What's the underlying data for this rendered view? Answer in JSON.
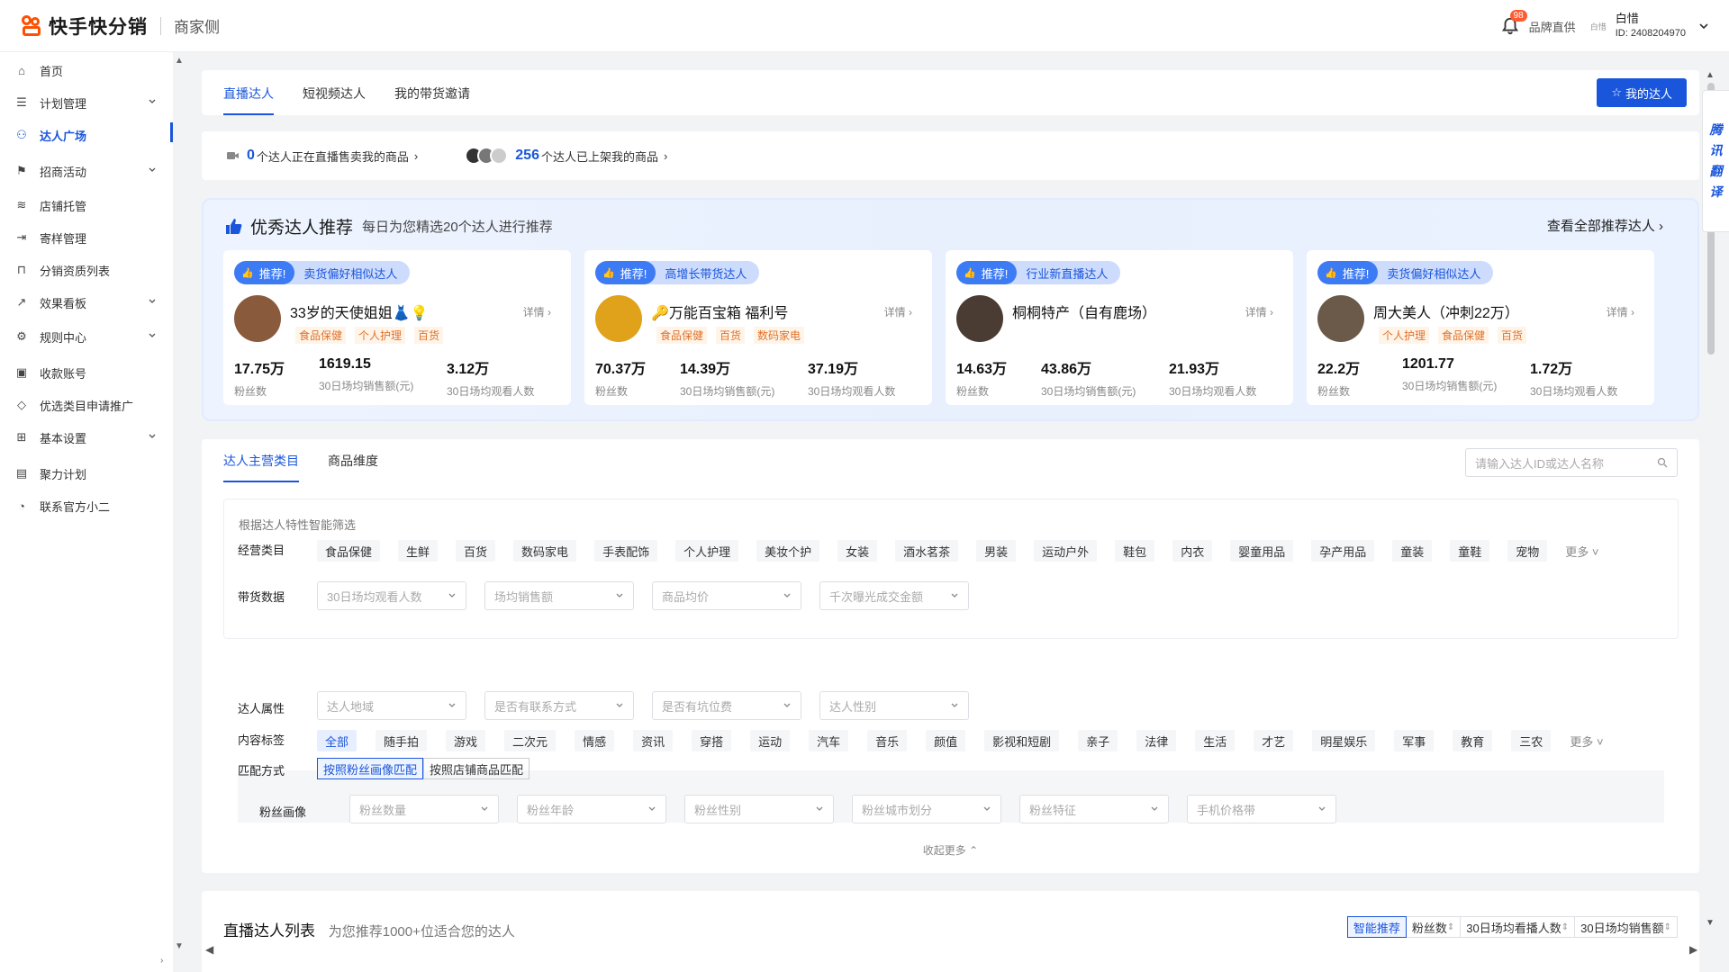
{
  "header": {
    "app_title": "快手快分销",
    "app_sub": "商家侧",
    "notif_count": "98",
    "brand_label": "品牌直供",
    "mini_logo": "白惜",
    "user_name": "白惜",
    "user_id": "ID: 2408204970"
  },
  "sidebar": {
    "items": [
      {
        "label": "首页",
        "icon": "home-icon"
      },
      {
        "label": "计划管理",
        "icon": "plan-icon",
        "expandable": true
      },
      {
        "label": "达人广场",
        "icon": "user-icon",
        "active": true
      },
      {
        "label": "招商活动",
        "icon": "flag-icon",
        "expandable": true
      },
      {
        "label": "店铺托管",
        "icon": "layers-icon"
      },
      {
        "label": "寄样管理",
        "icon": "send-icon"
      },
      {
        "label": "分销资质列表",
        "icon": "bag-icon"
      },
      {
        "label": "效果看板",
        "icon": "chart-icon",
        "expandable": true
      },
      {
        "label": "规则中心",
        "icon": "rule-icon",
        "expandable": true
      },
      {
        "label": "收款账号",
        "icon": "wallet-icon"
      },
      {
        "label": "优选类目申请推广",
        "icon": "tag-icon"
      },
      {
        "label": "基本设置",
        "icon": "grid-icon",
        "expandable": true
      },
      {
        "label": "聚力计划",
        "icon": "doc-icon"
      },
      {
        "label": "联系官方小二",
        "icon": "chat-icon"
      }
    ]
  },
  "top_tabs": [
    "直播达人",
    "短视频达人",
    "我的带货邀请"
  ],
  "my_talent_button": "我的达人",
  "stats": {
    "live_count": "0",
    "live_text": "个达人正在直播售卖我的商品",
    "listed_count": "256",
    "listed_text": "个达人已上架我的商品"
  },
  "recommend": {
    "title": "优秀达人推荐",
    "subtitle": "每日为您精选20个达人进行推荐",
    "view_all": "查看全部推荐达人",
    "pill_label": "推荐!",
    "detail_label": "详情",
    "cards": [
      {
        "reason": "卖货偏好相似达人",
        "name": "33岁的天使姐姐👗💡",
        "tags": [
          "食品保健",
          "个人护理",
          "百货"
        ],
        "fans": "17.75万",
        "sales": "1619.15",
        "viewers": "3.12万",
        "avatar_color": "#8a5a3c"
      },
      {
        "reason": "高增长带货达人",
        "name": "🔑万能百宝箱 福利号",
        "tags": [
          "食品保健",
          "百货",
          "数码家电"
        ],
        "fans": "70.37万",
        "sales": "14.39万",
        "viewers": "37.19万",
        "avatar_color": "#e0a21a"
      },
      {
        "reason": "行业新直播达人",
        "name": "桐桐特产（自有鹿场）",
        "tags": [],
        "fans": "14.63万",
        "sales": "43.86万",
        "viewers": "21.93万",
        "avatar_color": "#4a3b33"
      },
      {
        "reason": "卖货偏好相似达人",
        "name": "周大美人（冲刺22万）",
        "tags": [
          "个人护理",
          "食品保健",
          "百货"
        ],
        "fans": "22.2万",
        "sales": "1201.77",
        "viewers": "1.72万",
        "avatar_color": "#6b5a4a"
      }
    ],
    "stat_labels": [
      "粉丝数",
      "30日场均销售额(元)",
      "30日场均观看人数"
    ]
  },
  "filter": {
    "tabs": [
      "达人主营类目",
      "商品维度"
    ],
    "search_placeholder": "请输入达人ID或达人名称",
    "smart_title": "根据达人特性智能筛选",
    "category_label": "经营类目",
    "categories": [
      "食品保健",
      "生鲜",
      "百货",
      "数码家电",
      "手表配饰",
      "个人护理",
      "美妆个护",
      "女装",
      "酒水茗茶",
      "男装",
      "运动户外",
      "鞋包",
      "内衣",
      "婴童用品",
      "孕产用品",
      "童装",
      "童鞋",
      "宠物"
    ],
    "more": "更多",
    "sales_label": "带货数据",
    "sales_selects": [
      "30日场均观看人数",
      "场均销售额",
      "商品均价",
      "千次曝光成交金额"
    ],
    "attr_label": "达人属性",
    "attr_selects": [
      "达人地域",
      "是否有联系方式",
      "是否有坑位费",
      "达人性别"
    ],
    "content_label": "内容标签",
    "content_tags": [
      "全部",
      "随手拍",
      "游戏",
      "二次元",
      "情感",
      "资讯",
      "穿搭",
      "运动",
      "汽车",
      "音乐",
      "颜值",
      "影视和短剧",
      "亲子",
      "法律",
      "生活",
      "才艺",
      "明星娱乐",
      "军事",
      "教育",
      "三农"
    ],
    "match_label": "匹配方式",
    "match_options": [
      "按照粉丝画像匹配",
      "按照店铺商品匹配"
    ],
    "fans_label": "粉丝画像",
    "fans_selects": [
      "粉丝数量",
      "粉丝年龄",
      "粉丝性别",
      "粉丝城市划分",
      "粉丝特征",
      "手机价格带"
    ],
    "collapse": "收起更多"
  },
  "list": {
    "title": "直播达人列表",
    "subtitle": "为您推荐1000+位适合您的达人",
    "sorts": [
      "智能推荐",
      "粉丝数",
      "30日场均看播人数",
      "30日场均销售额"
    ]
  },
  "translate_tab": [
    "腾",
    "讯",
    "翻",
    "译"
  ],
  "colors": {
    "accent": "#1a56db",
    "brand": "#ff5000",
    "tag_orange": "#e0722b"
  }
}
